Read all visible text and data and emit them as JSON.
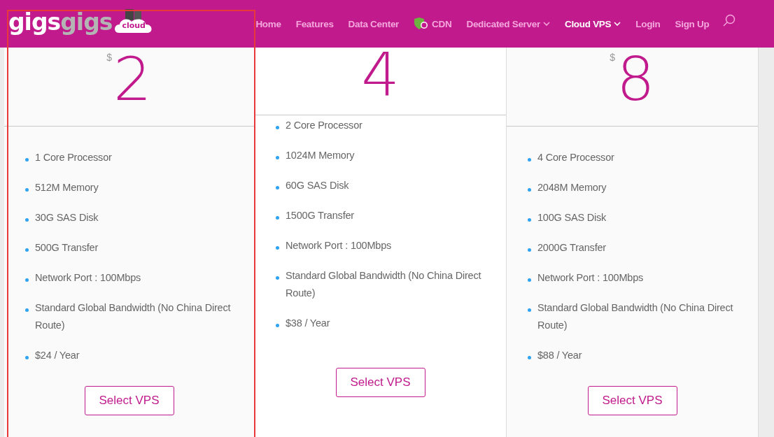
{
  "header": {
    "logo": {
      "part_1": "gigs",
      "part_2": "gigs",
      "badge": "cloud"
    },
    "nav": [
      {
        "label": "Home",
        "selected": false,
        "dropdown": false,
        "kind": "text"
      },
      {
        "label": "Features",
        "selected": false,
        "dropdown": false,
        "kind": "text"
      },
      {
        "label": "Data Center",
        "selected": false,
        "dropdown": false,
        "kind": "text"
      },
      {
        "label": "CDN",
        "selected": false,
        "dropdown": false,
        "kind": "badged"
      },
      {
        "label": "Dedicated Server",
        "selected": false,
        "dropdown": true,
        "kind": "text"
      },
      {
        "label": "Cloud VPS",
        "selected": true,
        "dropdown": true,
        "kind": "text"
      },
      {
        "label": "Login",
        "selected": false,
        "dropdown": false,
        "kind": "text"
      },
      {
        "label": "Sign Up",
        "selected": false,
        "dropdown": false,
        "kind": "text"
      }
    ]
  },
  "plans": [
    {
      "currency": "$",
      "price": "2",
      "featured": false,
      "highlighted": true,
      "features": [
        "1 Core Processor",
        "512M Memory",
        "30G SAS Disk",
        "500G Transfer",
        "Network Port : 100Mbps",
        "Standard Global Bandwidth (No China Direct Route)",
        "$24 / Year"
      ],
      "button": "Select VPS"
    },
    {
      "price": "4",
      "featured": true,
      "highlighted": false,
      "features": [
        "2 Core Processor",
        "1024M Memory",
        "60G SAS Disk",
        "1500G Transfer",
        "Network Port : 100Mbps",
        "Standard Global Bandwidth (No China Direct Route)",
        "$38 / Year"
      ],
      "button": "Select VPS"
    },
    {
      "currency": "$",
      "price": "8",
      "featured": false,
      "highlighted": false,
      "features": [
        "4 Core Processor",
        "2048M Memory",
        "100G SAS Disk",
        "2000G Transfer",
        "Network Port : 100Mbps",
        "Standard Global Bandwidth (No China Direct Route)",
        "$88 / Year"
      ],
      "button": "Select VPS"
    }
  ]
}
